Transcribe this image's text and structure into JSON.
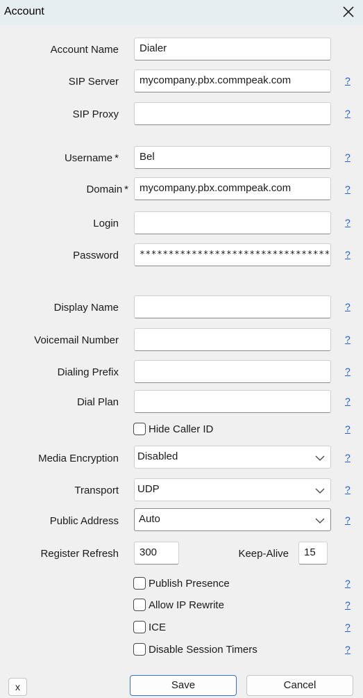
{
  "window": {
    "title": "Account"
  },
  "help_text": "?",
  "fields": {
    "account_name": {
      "label": "Account Name",
      "value": "Dialer"
    },
    "sip_server": {
      "label": "SIP Server",
      "value": "mycompany.pbx.commpeak.com"
    },
    "sip_proxy": {
      "label": "SIP Proxy",
      "value": ""
    },
    "username": {
      "label": "Username",
      "required": "*",
      "value": "Bel"
    },
    "domain": {
      "label": "Domain",
      "required": "*",
      "value": "mycompany.pbx.commpeak.com"
    },
    "login": {
      "label": "Login",
      "value": ""
    },
    "password": {
      "label": "Password",
      "value": "************************************"
    },
    "display_name": {
      "label": "Display Name",
      "value": ""
    },
    "voicemail_number": {
      "label": "Voicemail Number",
      "value": ""
    },
    "dialing_prefix": {
      "label": "Dialing Prefix",
      "value": ""
    },
    "dial_plan": {
      "label": "Dial Plan",
      "value": ""
    }
  },
  "checkboxes": {
    "hide_caller_id": {
      "label": "Hide Caller ID",
      "checked": false
    },
    "publish_presence": {
      "label": "Publish Presence",
      "checked": false
    },
    "allow_ip_rewrite": {
      "label": "Allow IP Rewrite",
      "checked": false
    },
    "ice": {
      "label": "ICE",
      "checked": false
    },
    "disable_session_timers": {
      "label": "Disable Session Timers",
      "checked": false
    }
  },
  "selects": {
    "media_encryption": {
      "label": "Media Encryption",
      "value": "Disabled"
    },
    "transport": {
      "label": "Transport",
      "value": "UDP"
    },
    "public_address": {
      "label": "Public Address",
      "value": "Auto"
    }
  },
  "register_refresh": {
    "label": "Register Refresh",
    "value": "300"
  },
  "keep_alive": {
    "label": "Keep-Alive",
    "value": "15"
  },
  "buttons": {
    "x": "x",
    "save": "Save",
    "cancel": "Cancel"
  }
}
